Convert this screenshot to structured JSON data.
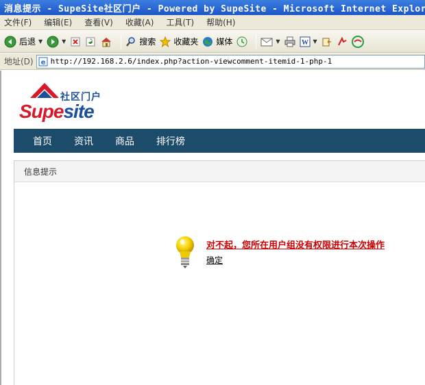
{
  "window": {
    "title": "消息提示 - SupeSite社区门户 - Powered by SupeSite - Microsoft Internet Explor"
  },
  "menu": [
    {
      "label": "文件(F)"
    },
    {
      "label": "编辑(E)"
    },
    {
      "label": "查看(V)"
    },
    {
      "label": "收藏(A)"
    },
    {
      "label": "工具(T)"
    },
    {
      "label": "帮助(H)"
    }
  ],
  "toolbar": {
    "back_label": "后退",
    "search_label": "搜索",
    "favorites_label": "收藏夹",
    "media_label": "媒体"
  },
  "address": {
    "label": "地址(D)",
    "url": "http://192.168.2.6/index.php?action-viewcomment-itemid-1-php-1"
  },
  "site": {
    "logo_cn": "社区门户",
    "logo_part1": "Supe",
    "logo_part2": "site"
  },
  "nav": [
    {
      "label": "首页"
    },
    {
      "label": "资讯"
    },
    {
      "label": "商品"
    },
    {
      "label": "排行榜"
    }
  ],
  "message": {
    "header": "信息提示",
    "text": "对不起，您所在用户组没有权限进行本次操作",
    "ok_label": "确定"
  },
  "colors": {
    "nav_bg": "#1d4c6b",
    "error_text": "#cc0000",
    "logo_red": "#d7192a",
    "logo_blue": "#1a4f9c"
  }
}
